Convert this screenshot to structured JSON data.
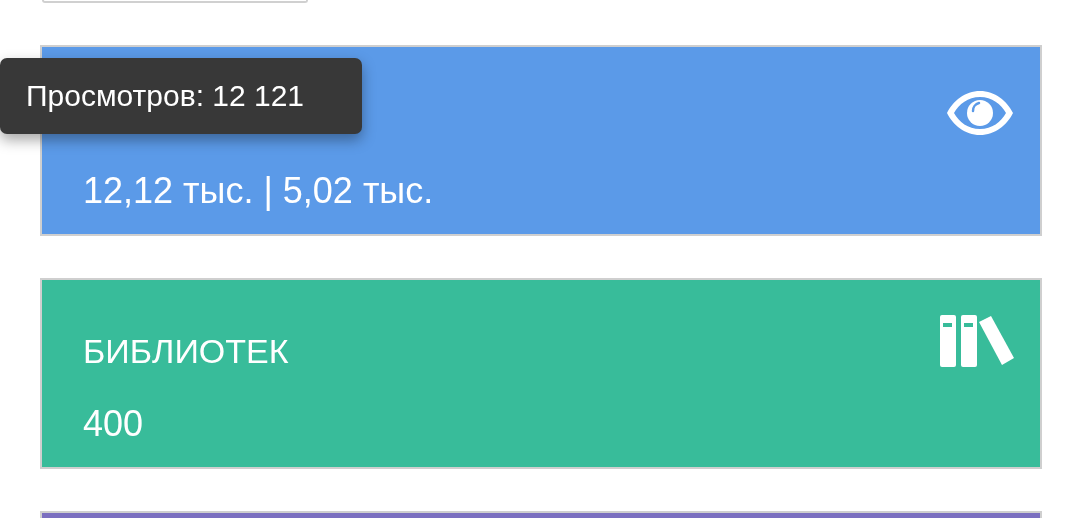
{
  "cards": [
    {
      "kind": "views",
      "color": "#5b9ae8",
      "value": "12,12 тыс. | 5,02 тыс."
    },
    {
      "kind": "libraries",
      "color": "#38bc9a",
      "title": "БИБЛИОТЕК",
      "value": "400"
    },
    {
      "kind": "other",
      "color": "#7b6fc0"
    }
  ],
  "tooltip": {
    "text": "Просмотров: 12 121"
  }
}
